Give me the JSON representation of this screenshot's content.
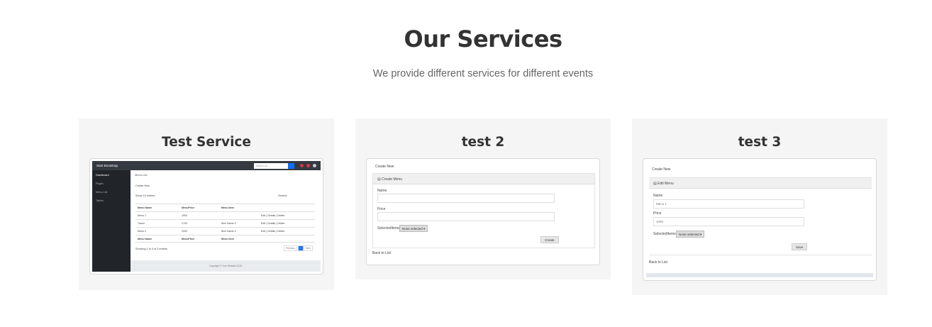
{
  "section": {
    "title": "Our Services",
    "subtitle": "We provide different services for different events"
  },
  "cards": [
    {
      "title": "Test Service",
      "screenshot": {
        "brand": "Start Bootstrap",
        "search_placeholder": "Search for...",
        "sidebar": [
          "Dashboard",
          "Pages",
          "Menu List",
          "Tables"
        ],
        "tab": "Menu List",
        "create_new": "Create New",
        "show_entries": "Show  10  entries",
        "search_label": "Search:",
        "columns": [
          "Menu Name",
          "MenuPrice",
          "Menu Item",
          ""
        ],
        "rows": [
          [
            "Menu 1",
            "1000",
            "",
            "Edit | Details | Delete"
          ],
          [
            "Travel",
            "1700",
            "Item Name 2",
            "Edit | Details | Delete"
          ],
          [
            "Menu 2",
            "2000",
            "Item Name 4",
            "Edit | Details | Delete"
          ]
        ],
        "footer_row": [
          "Menu Name",
          "MenuPrice",
          "Menu Item",
          ""
        ],
        "showing": "Showing 1 to 3 of 3 entries",
        "pager": [
          "Previous",
          "1",
          "Next"
        ],
        "copyright": "Copyright © Your Website 2019"
      }
    },
    {
      "title": "test 2",
      "screenshot": {
        "create_new": "Create New",
        "panel_title": "Create Menu",
        "name_label": "Name",
        "price_label": "Price",
        "selected_label": "SelectedItems",
        "select_value": "None selected",
        "button": "Create",
        "back": "Back to List"
      }
    },
    {
      "title": "test 3",
      "screenshot": {
        "create_new": "Create New",
        "panel_title": "Edit Menu",
        "name_label": "Name",
        "name_value": "Menu 1",
        "price_label": "Price",
        "price_value": "1000",
        "selected_label": "SelectedItems",
        "select_value": "None selected",
        "button": "Save",
        "back": "Back to List"
      }
    }
  ]
}
